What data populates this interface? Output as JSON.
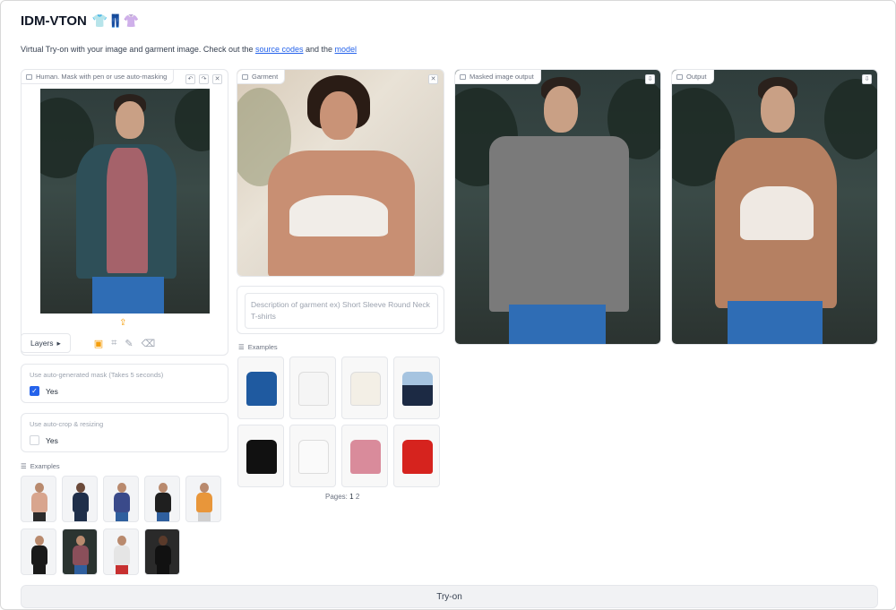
{
  "app": {
    "title": "IDM-VTON",
    "title_emojis": "👕👖👚",
    "subtitle_prefix": "Virtual Try-on with your image and garment image. Check out the ",
    "link_source": "source codes",
    "subtitle_mid": " and the ",
    "link_model": "model"
  },
  "human_panel": {
    "label": "Human. Mask with pen or use auto-masking",
    "layers_label": "Layers",
    "auto_mask": {
      "title": "Use auto-generated mask (Takes 5 seconds)",
      "option": "Yes",
      "checked": true
    },
    "auto_crop": {
      "title": "Use auto-crop & resizing",
      "option": "Yes",
      "checked": false
    },
    "examples_label": "Examples"
  },
  "garment_panel": {
    "label": "Garment",
    "description_placeholder": "Description of garment ex) Short Sleeve Round Neck T-shirts",
    "examples_label": "Examples",
    "pages_label": "Pages:",
    "pages": [
      "1",
      "2"
    ]
  },
  "masked_panel": {
    "label": "Masked image output"
  },
  "output_panel": {
    "label": "Output"
  },
  "actions": {
    "try_on_label": "Try-on"
  },
  "colors": {
    "accent": "#2563eb",
    "tool_active": "#f59e0b",
    "mask_gray": "#7a7a7a"
  }
}
